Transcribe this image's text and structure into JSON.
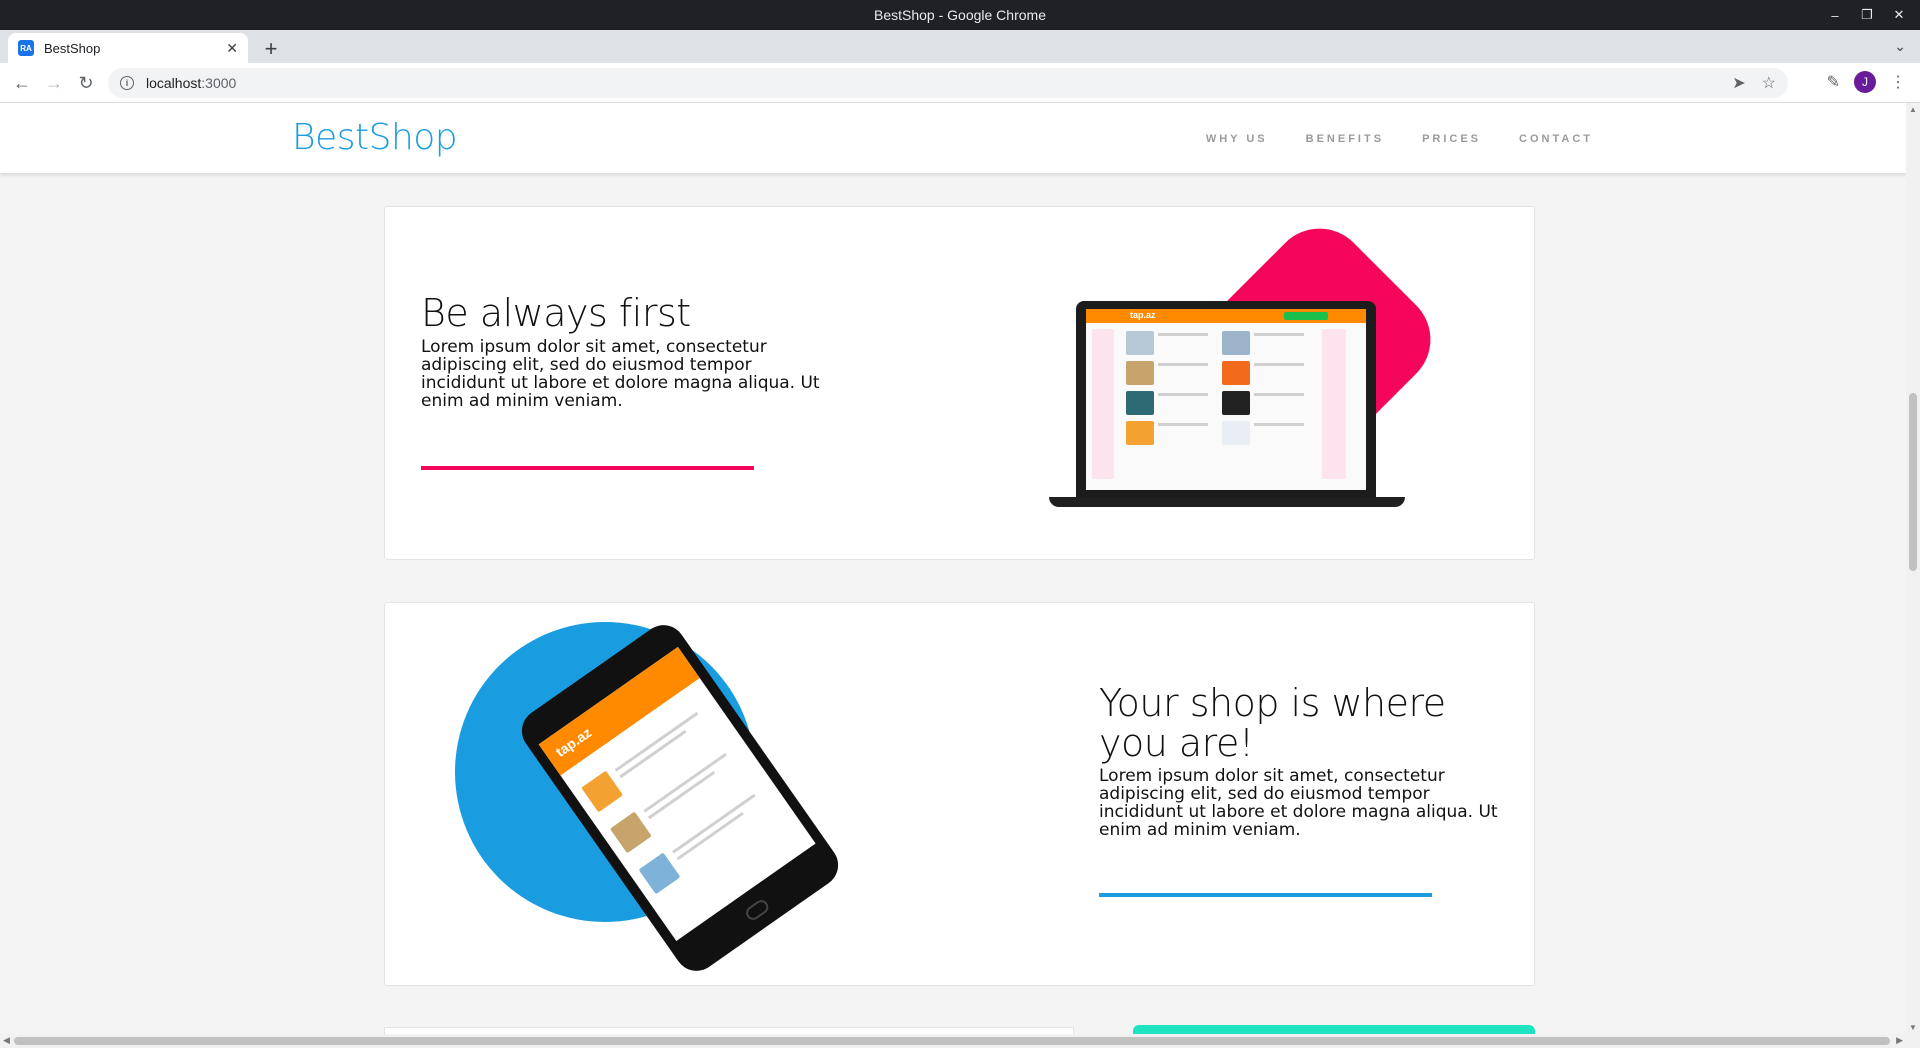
{
  "window": {
    "title": "BestShop - Google Chrome"
  },
  "tab": {
    "favicon_text": "RA",
    "title": "BestShop"
  },
  "address_bar": {
    "host": "localhost",
    "port": ":3000"
  },
  "profile": {
    "initial": "J"
  },
  "site": {
    "logo": "BestShop",
    "nav": [
      "WHY US",
      "BENEFITS",
      "PRICES",
      "CONTACT"
    ]
  },
  "sections": [
    {
      "title": "Be always first",
      "text": "Lorem ipsum dolor sit amet, consectetur adipiscing elit, sed do eiusmod tempor incididunt ut labore et dolore magna aliqua. Ut enim ad minim veniam.",
      "accent": "#f4065a",
      "image_text": "tap.az"
    },
    {
      "title": "Your shop is where you are!",
      "text": "Lorem ipsum dolor sit amet, consectetur adipiscing elit, sed do eiusmod tempor incididunt ut labore et dolore magna aliqua. Ut enim ad minim veniam.",
      "accent": "#1a9de0",
      "image_text": "tap.az"
    }
  ],
  "colors": {
    "brand": "#1a9de0",
    "pink": "#f4065a",
    "teal": "#1ee3c0"
  }
}
